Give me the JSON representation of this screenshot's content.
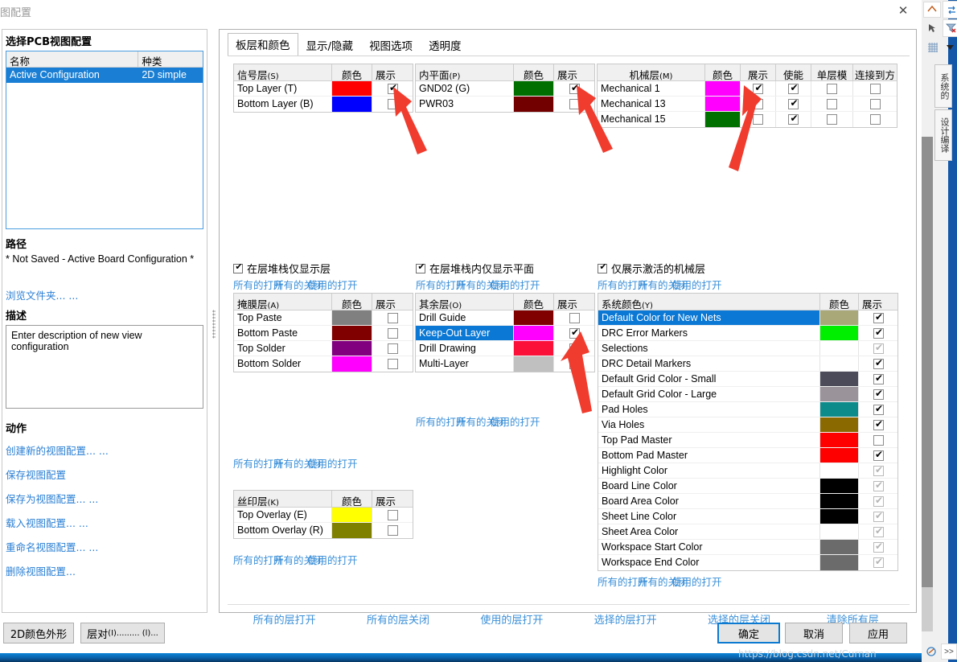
{
  "window": {
    "title": "图配置",
    "close_icon": "close-icon"
  },
  "left": {
    "select_config_heading": "选择PCB视图配置",
    "config_table": {
      "columns": [
        "名称",
        "种类"
      ],
      "rows": [
        {
          "name": "Active Configuration",
          "kind": "2D simple",
          "selected": true
        }
      ]
    },
    "path_heading": "路径",
    "path_value": "* Not Saved - Active Board Configuration *",
    "browse_link": "浏览文件夹... ...",
    "desc_heading": "描述",
    "desc_value": "Enter description of new view configuration",
    "actions_heading": "动作",
    "actions": [
      "创建新的视图配置... ...",
      "保存视图配置",
      "保存为视图配置... ...",
      "载入视图配置... ...",
      "重命名视图配置... ...",
      "删除视图配置..."
    ]
  },
  "tabs": [
    {
      "label": "板层和颜色",
      "active": true
    },
    {
      "label": "显示/隐藏",
      "active": false
    },
    {
      "label": "视图选项",
      "active": false
    },
    {
      "label": "透明度",
      "active": false
    }
  ],
  "tri_link": {
    "all_on": "所有的打开",
    "all_off": "所有的关闭",
    "used_on": "使用的打开"
  },
  "signal_layers": {
    "columns": [
      "信号层",
      "(S)",
      "颜色",
      "展示"
    ],
    "header_name": "信号层",
    "header_sub": "(S)",
    "header_color": "颜色",
    "header_show": "展示",
    "rows": [
      {
        "name": "Top Layer (T)",
        "color": "#ff0000",
        "show": true
      },
      {
        "name": "Bottom Layer (B)",
        "color": "#0000ff",
        "show": false
      }
    ]
  },
  "internal_planes": {
    "header_name": "内平面",
    "header_sub": "(P)",
    "header_color": "颜色",
    "header_show": "展示",
    "rows": [
      {
        "name": "GND02 (G)",
        "color": "#006f00",
        "show": true
      },
      {
        "name": "PWR03",
        "color": "#730000",
        "show": false
      }
    ]
  },
  "mechanical_layers": {
    "header_name": "机械层",
    "header_sub": "(M)",
    "header_color": "颜色",
    "header_show": "展示",
    "header_enable": "使能",
    "header_single": "单层模",
    "header_connect": "连接到方",
    "rows": [
      {
        "name": "Mechanical 1",
        "color": "#ff00ff",
        "show": true,
        "enable": true,
        "single": false,
        "connect": false
      },
      {
        "name": "Mechanical 13",
        "color": "#ff00ff",
        "show": false,
        "enable": true,
        "single": false,
        "connect": false
      },
      {
        "name": "Mechanical 15",
        "color": "#007000",
        "show": false,
        "enable": true,
        "single": false,
        "connect": false
      }
    ]
  },
  "opt_stack_layers_only": "在层堆栈仅显示层",
  "opt_stack_planes_only": "在层堆栈内仅显示平面",
  "opt_active_mech_only": "仅展示激活的机械层",
  "mask_layers": {
    "header_name": "掩膜层",
    "header_sub": "(A)",
    "header_color": "颜色",
    "header_show": "展示",
    "rows": [
      {
        "name": "Top Paste",
        "color": "#808080",
        "show": false
      },
      {
        "name": "Bottom Paste",
        "color": "#800000",
        "show": false
      },
      {
        "name": "Top Solder",
        "color": "#800080",
        "show": false
      },
      {
        "name": "Bottom Solder",
        "color": "#ff00ff",
        "show": false
      }
    ]
  },
  "other_layers": {
    "header_name": "其余层",
    "header_sub": "(O)",
    "header_color": "颜色",
    "header_show": "展示",
    "rows": [
      {
        "name": "Drill Guide",
        "color": "#800000",
        "show": false,
        "selected": false
      },
      {
        "name": "Keep-Out Layer",
        "color": "#ff00ff",
        "show": true,
        "selected": true
      },
      {
        "name": "Drill Drawing",
        "color": "#fa1038",
        "show": false,
        "selected": false
      },
      {
        "name": "Multi-Layer",
        "color": "#c0c0c0",
        "show": false,
        "selected": false
      }
    ]
  },
  "silk_layers": {
    "header_name": "丝印层",
    "header_sub": "(K)",
    "header_color": "颜色",
    "header_show": "展示",
    "rows": [
      {
        "name": "Top Overlay (E)",
        "color": "#ffff00",
        "show": false
      },
      {
        "name": "Bottom Overlay (R)",
        "color": "#808000",
        "show": false
      }
    ]
  },
  "system_colors": {
    "header_name": "系统颜色",
    "header_sub": "(Y)",
    "header_color": "颜色",
    "header_show": "展示",
    "rows": [
      {
        "name": "Default Color for New Nets",
        "color": "#a8a878",
        "show": true,
        "disabled": false,
        "selected": true
      },
      {
        "name": "DRC Error Markers",
        "color": "#00ee00",
        "show": true,
        "disabled": false,
        "selected": false
      },
      {
        "name": "Selections",
        "color": "",
        "show": true,
        "disabled": true,
        "selected": false
      },
      {
        "name": "DRC Detail Markers",
        "color": "",
        "show": true,
        "disabled": false,
        "selected": false
      },
      {
        "name": "Default Grid Color - Small",
        "color": "#4b4b5a",
        "show": true,
        "disabled": false,
        "selected": false
      },
      {
        "name": "Default Grid Color - Large",
        "color": "#9a949a",
        "show": true,
        "disabled": false,
        "selected": false
      },
      {
        "name": "Pad Holes",
        "color": "#0d8a8a",
        "show": true,
        "disabled": false,
        "selected": false
      },
      {
        "name": "Via Holes",
        "color": "#8a6a00",
        "show": true,
        "disabled": false,
        "selected": false
      },
      {
        "name": "Top Pad Master",
        "color": "#ff0000",
        "show": false,
        "disabled": false,
        "selected": false
      },
      {
        "name": "Bottom Pad Master",
        "color": "#ff0000",
        "show": true,
        "disabled": false,
        "selected": false
      },
      {
        "name": "Highlight Color",
        "color": "",
        "show": true,
        "disabled": true,
        "selected": false
      },
      {
        "name": "Board Line Color",
        "color": "#000000",
        "show": true,
        "disabled": true,
        "selected": false
      },
      {
        "name": "Board Area Color",
        "color": "#000000",
        "show": true,
        "disabled": true,
        "selected": false
      },
      {
        "name": "Sheet Line Color",
        "color": "#000000",
        "show": true,
        "disabled": true,
        "selected": false
      },
      {
        "name": "Sheet Area Color",
        "color": "",
        "show": true,
        "disabled": true,
        "selected": false
      },
      {
        "name": "Workspace Start Color",
        "color": "#6b6b6b",
        "show": true,
        "disabled": true,
        "selected": false
      },
      {
        "name": "Workspace End Color",
        "color": "#6b6b6b",
        "show": true,
        "disabled": true,
        "selected": false
      }
    ]
  },
  "bottom_links": [
    "所有的层打开",
    "所有的层关闭",
    "使用的层打开",
    "选择的层打开",
    "选择的层关闭",
    "清除所有层"
  ],
  "buttons": {
    "color_2d": "2D颜色外形",
    "layer_pair_main": "层对",
    "layer_pair_sub": "(I)......... (l)...",
    "ok": "确定",
    "cancel": "取消",
    "apply": "应用"
  },
  "right_strip": {
    "vtab_1": "系统的",
    "vtab_2": "设计编译"
  },
  "watermark": "https://blog.csdn.net/Curnan"
}
